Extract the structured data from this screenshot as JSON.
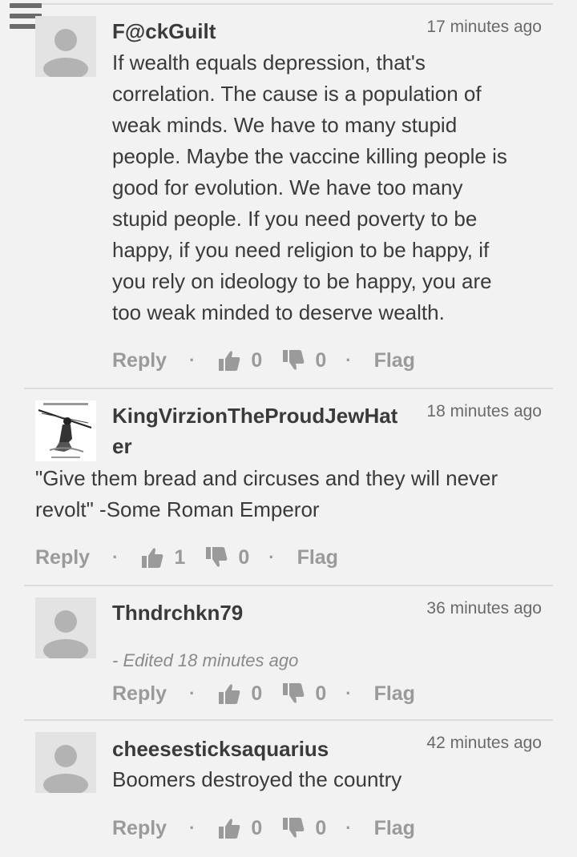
{
  "comments": [
    {
      "username": "F@ckGuilt",
      "timestamp": "17 minutes ago",
      "body_lines": [
        "If wealth equals depression, that's",
        "correlation. The cause is a population of",
        "weak minds. We have to many stupid",
        "people. Maybe the vaccine killing people is",
        "good for evolution. We have too many",
        "stupid people. If you need poverty to be",
        "happy, if you need religion to be happy, if",
        "you rely on ideology to be happy, you are",
        "too weak minded to deserve wealth."
      ],
      "reply": "Reply",
      "likes": "0",
      "dislikes": "0",
      "flag": "Flag",
      "avatar": "default-user-icon"
    },
    {
      "username_lines": [
        "KingVirzionTheProudJewHat",
        "er"
      ],
      "timestamp": "18 minutes ago",
      "body_lines": [
        "\"Give them bread and circuses and they will never",
        "revolt\" -Some Roman Emperor"
      ],
      "reply": "Reply",
      "likes": "1",
      "dislikes": "0",
      "flag": "Flag",
      "avatar": "custom-drawing-avatar"
    },
    {
      "username": "Thndrchkn79",
      "timestamp": "36 minutes ago",
      "edited": "- Edited 18 minutes ago",
      "reply": "Reply",
      "likes": "0",
      "dislikes": "0",
      "flag": "Flag",
      "avatar": "default-user-icon"
    },
    {
      "username": "cheesesticksaquarius",
      "timestamp": "42 minutes ago",
      "body_lines": [
        "Boomers destroyed the country"
      ],
      "reply": "Reply",
      "likes": "0",
      "dislikes": "0",
      "flag": "Flag",
      "avatar": "default-user-icon"
    }
  ],
  "separator": "·",
  "colors": {
    "background": "#f2f2f2",
    "text": "#3a3a3a",
    "muted": "#9a9a9a",
    "avatar_bg": "#e3e3e3",
    "avatar_fg": "#b3b3b3"
  }
}
